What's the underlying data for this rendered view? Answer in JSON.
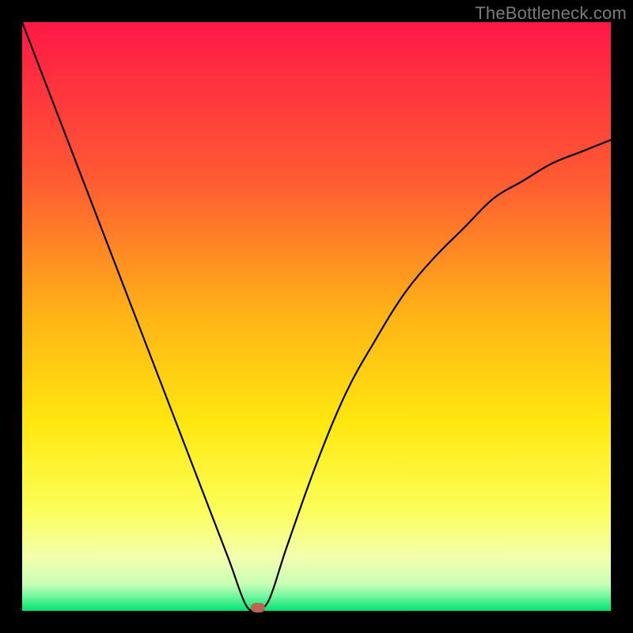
{
  "watermark": {
    "text": "TheBottleneck.com"
  },
  "chart_data": {
    "type": "line",
    "title": "",
    "xlabel": "",
    "ylabel": "",
    "xlim": [
      0,
      100
    ],
    "ylim": [
      0,
      100
    ],
    "x": [
      0,
      5,
      10,
      15,
      20,
      25,
      30,
      35,
      38,
      40,
      42,
      45,
      50,
      55,
      60,
      65,
      70,
      75,
      80,
      85,
      90,
      95,
      100
    ],
    "values": [
      100,
      87,
      74,
      61,
      48,
      35,
      22,
      9,
      1,
      0,
      2,
      11,
      25,
      37,
      46,
      54,
      60,
      65,
      70,
      73,
      76,
      78,
      80
    ],
    "series": [
      {
        "name": "bottleneck-curve",
        "stroke": "#000000"
      }
    ],
    "marker": {
      "x": 40,
      "y": 0,
      "color": "#bc6452"
    },
    "gradient_stops": [
      {
        "offset": 0.0,
        "color": "#ff1846"
      },
      {
        "offset": 0.27,
        "color": "#ff5b32"
      },
      {
        "offset": 0.5,
        "color": "#ffb416"
      },
      {
        "offset": 0.68,
        "color": "#ffe70f"
      },
      {
        "offset": 0.83,
        "color": "#fbff59"
      },
      {
        "offset": 0.91,
        "color": "#f3ffaf"
      },
      {
        "offset": 0.955,
        "color": "#c8ffb4"
      },
      {
        "offset": 0.975,
        "color": "#72f6a0"
      },
      {
        "offset": 1.0,
        "color": "#00e36f"
      }
    ]
  }
}
